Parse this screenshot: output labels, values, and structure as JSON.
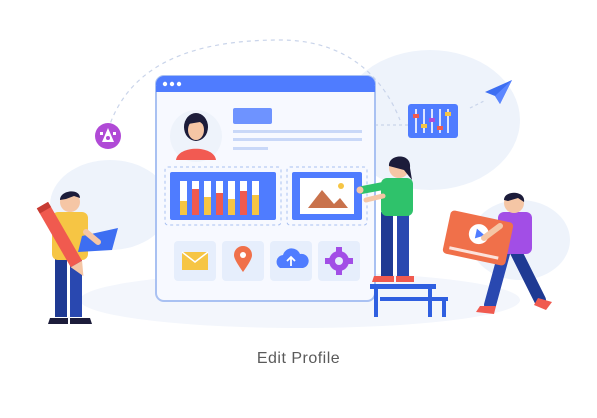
{
  "caption": "Edit Profile",
  "colors": {
    "accent_blue": "#4f7cff",
    "window_border": "#a9c1f2",
    "window_fill": "#f7f9ff",
    "bar_yellow": "#f6c544",
    "bar_red": "#f05a4f",
    "profile_red": "#f25a52",
    "green_shirt": "#2fc26b",
    "purple_shirt": "#a24ee6",
    "orange_card": "#f0704a",
    "navy_pants": "#1f3a93",
    "bg_blob": "#eef3fb"
  },
  "icons": {
    "app_tiles": [
      "mail-icon",
      "location-pin-icon",
      "cloud-upload-icon",
      "gear-icon"
    ],
    "floating": [
      "pen-tool-icon",
      "paper-plane-icon",
      "sliders-icon"
    ],
    "media": [
      "image-icon",
      "play-icon"
    ]
  }
}
